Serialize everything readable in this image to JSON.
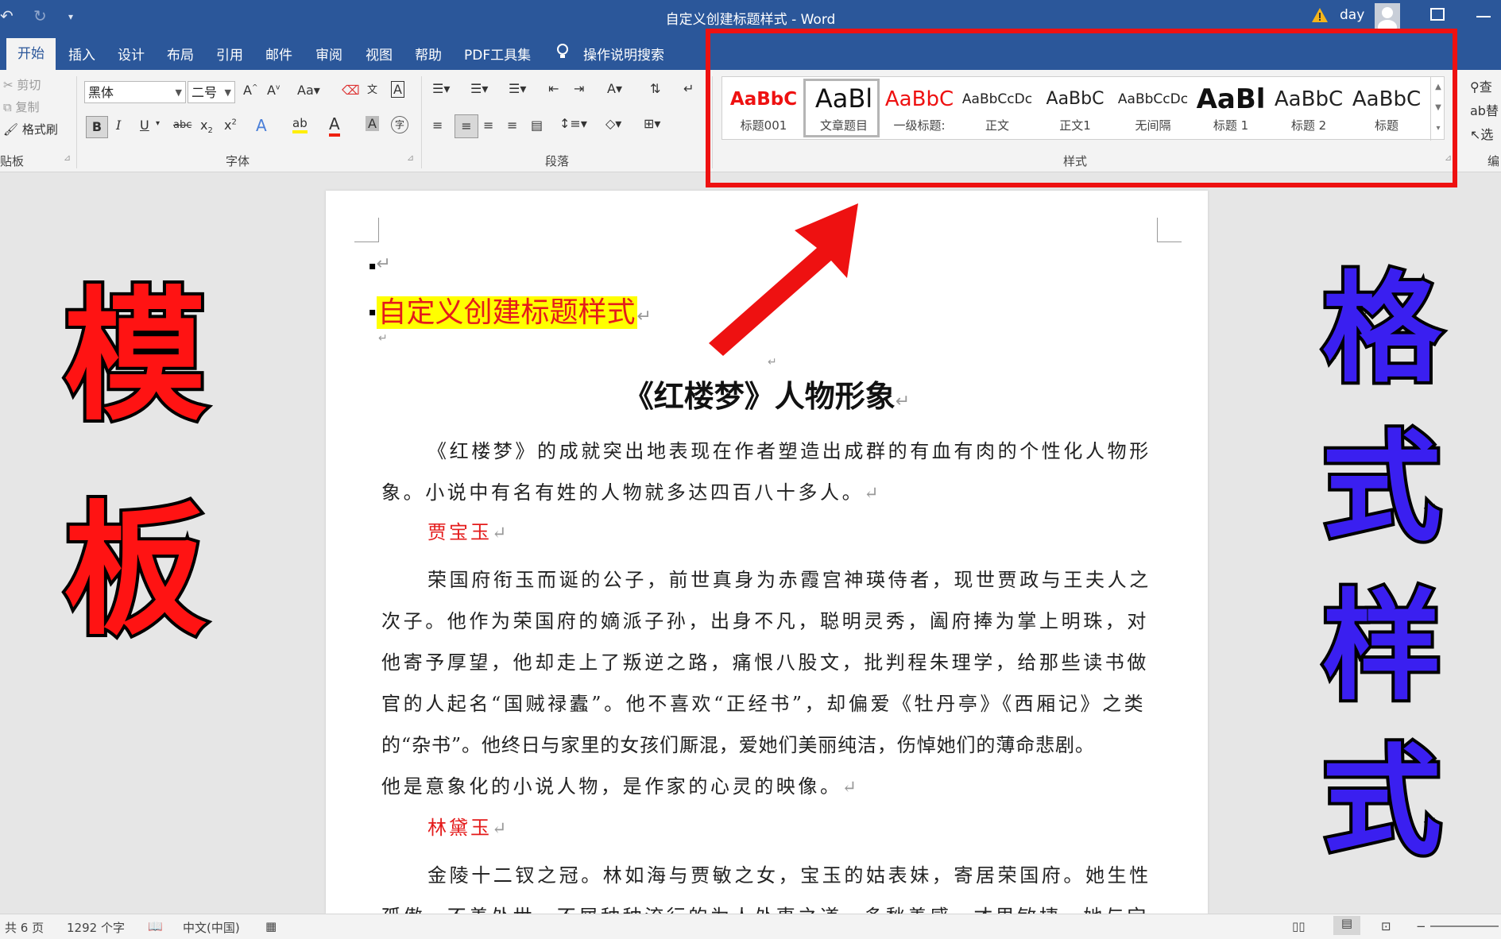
{
  "titlebar": {
    "title": "自定义创建标题样式 - Word",
    "user": "day"
  },
  "tabs": [
    "开始",
    "插入",
    "设计",
    "布局",
    "引用",
    "邮件",
    "审阅",
    "视图",
    "帮助",
    "PDF工具集",
    "操作说明搜索"
  ],
  "clipboard": {
    "cut": "剪切",
    "copy": "复制",
    "painter": "格式刷",
    "label": "贴板"
  },
  "font": {
    "name": "黑体",
    "size": "二号",
    "label": "字体",
    "change_case": "Aa"
  },
  "paragraph": {
    "label": "段落"
  },
  "styles": {
    "label": "样式",
    "items": [
      {
        "preview": "AaBbC",
        "name": "标题001",
        "color": "#ee1111"
      },
      {
        "preview": "AaBl",
        "name": "文章题目",
        "color": "#111111"
      },
      {
        "preview": "AaBbC",
        "name": "一级标题:",
        "color": "#ee1111"
      },
      {
        "preview": "AaBbCcDc",
        "name": "正文",
        "color": "#222222"
      },
      {
        "preview": "AaBbC",
        "name": "正文1",
        "color": "#222222"
      },
      {
        "preview": "AaBbCcDc",
        "name": "无间隔",
        "color": "#222222"
      },
      {
        "preview": "AaBl",
        "name": "标题 1",
        "color": "#111111"
      },
      {
        "preview": "AaBbC",
        "name": "标题 2",
        "color": "#222222"
      },
      {
        "preview": "AaBbC",
        "name": "标题",
        "color": "#222222"
      }
    ]
  },
  "editing": {
    "find": "查",
    "replace": "替",
    "select": "选",
    "label": "编"
  },
  "document": {
    "heading_highlight": "自定义创建标题样式",
    "title": "《红楼梦》人物形象",
    "p1_line1": "《红楼梦》的成就突出地表现在作者塑造出成群的有血有肉的个性化人物形",
    "p1_line2": "象。小说中有名有姓的人物就多达四百八十多人。",
    "name1": "贾宝玉",
    "p2_lines": [
      "荣国府衔玉而诞的公子，前世真身为赤霞宫神瑛侍者，现世贾政与王夫人之",
      "次子。他作为荣国府的嫡派子孙，出身不凡，聪明灵秀，阖府捧为掌上明珠，对",
      "他寄予厚望，他却走上了叛逆之路，痛恨八股文，批判程朱理学，给那些读书做",
      "官的人起名“国贼禄蠹”。他不喜欢“正经书”，却偏爱《牡丹亭》《西厢记》之类",
      "的“杂书”。他终日与家里的女孩们厮混，爱她们美丽纯洁，伤悼她们的薄命悲剧。",
      "他是意象化的小说人物，是作家的心灵的映像。"
    ],
    "name2": "林黛玉",
    "p3_line1": "金陵十二钗之冠。林如海与贾敏之女，宝玉的姑表妹，寄居荣国府。她生性",
    "p3_line2": "孤傲，不善处世，不屑种种流行的为人处事之道，多愁善感，才思敏捷，她与宝"
  },
  "overlay": {
    "left": [
      "模",
      "板"
    ],
    "right": [
      "格",
      "式",
      "样",
      "式"
    ]
  },
  "status": {
    "pages": "共 6 页",
    "words": "1292 个字",
    "lang": "中文(中国)"
  }
}
